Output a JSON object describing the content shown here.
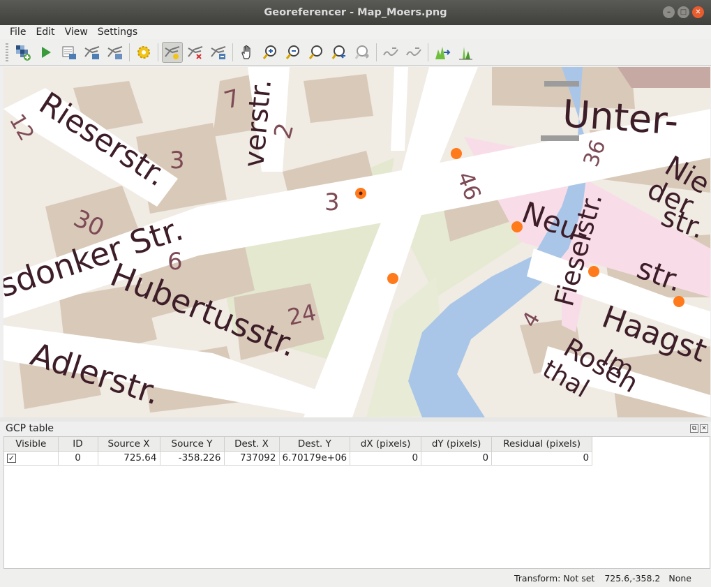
{
  "window": {
    "title": "Georeferencer - Map_Moers.png"
  },
  "menu": [
    "File",
    "Edit",
    "View",
    "Settings"
  ],
  "toolbar": {
    "icons": [
      "open-raster-icon",
      "start-georeferencing-icon",
      "generate-gdal-script-icon",
      "load-gcp-points-icon",
      "save-gcp-points-icon",
      "transformation-settings-icon",
      "add-point-icon",
      "delete-point-icon",
      "move-gcp-point-icon",
      "pan-icon",
      "zoom-in-icon",
      "zoom-out-icon",
      "zoom-to-layer-icon",
      "zoom-last-icon",
      "zoom-next-icon",
      "link-georeferencer-to-qgis-icon",
      "link-qgis-to-georeferencer-icon",
      "full-histogram-stretch-icon",
      "local-histogram-stretch-icon"
    ]
  },
  "map": {
    "labels": {
      "riesserstr": "Rieserstr.",
      "num_12": "12",
      "num_30": "30",
      "num_3a": "3",
      "num_7": "7",
      "num_2": "2",
      "num_3b": "3",
      "verstr": "verstr.",
      "dinker": "sdonker Str.",
      "hubertus": "Hubertusstr.",
      "num_6": "6",
      "num_24": "24",
      "adler": "Adlerstr.",
      "num_46": "46",
      "unter": "Unter-",
      "nie": "Nie",
      "derstr": "der",
      "str1": "str.",
      "neu": "Neu-",
      "str2": "str.",
      "fieselstr": "Fieselstr.",
      "num_36": "36",
      "haags": "Haagst",
      "im": "Im",
      "rosen": "Rosen",
      "thal": "thal",
      "num_4": "4"
    },
    "gcp_color": "#ff7a1a",
    "colors": {
      "background": "#f0ebe3",
      "building": "#d9c9b9",
      "green": "#e3e8cf",
      "road": "#ffffff",
      "water": "#a9c6e8",
      "pink": "#f8dde8",
      "text": "#6a2b3a"
    }
  },
  "gcp_panel": {
    "title": "GCP table",
    "columns": [
      "Visible",
      "ID",
      "Source X",
      "Source Y",
      "Dest. X",
      "Dest. Y",
      "dX (pixels)",
      "dY (pixels)",
      "Residual (pixels)"
    ],
    "rows": [
      {
        "visible": "✓",
        "id": "0",
        "source_x": "725.64",
        "source_y": "-358.226",
        "dest_x": "737092",
        "dest_y": "6.70179e+06",
        "dx": "0",
        "dy": "0",
        "residual": "0"
      }
    ]
  },
  "status": {
    "transform": "Transform: Not set",
    "coords": "725.6,-358.2",
    "crs": "None"
  }
}
